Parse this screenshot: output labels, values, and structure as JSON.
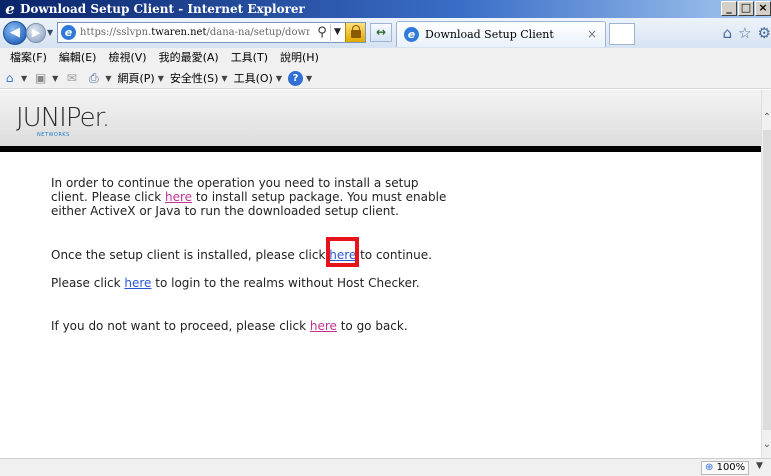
{
  "window": {
    "title": "Download Setup Client - Internet Explorer",
    "buttons": [
      "_",
      "□",
      "×"
    ]
  },
  "address_bar": {
    "url_prefix": "https://sslvpn.",
    "url_domain": "twaren.net",
    "url_path": "/dana-na/setup/download.cg",
    "search_glyph": "⚲",
    "dropdown_glyph": "▼"
  },
  "tab": {
    "label": "Download Setup Client",
    "close": "×"
  },
  "toolbar_icons": [
    "home-icon",
    "star-icon",
    "gear-icon"
  ],
  "menu": {
    "items": [
      "檔案(F)",
      "編輯(E)",
      "檢視(V)",
      "我的最愛(A)",
      "工具(T)",
      "說明(H)"
    ]
  },
  "command_bar": {
    "page_label": "網頁(P)",
    "safety_label": "安全性(S)",
    "tools_label": "工具(O)"
  },
  "logo": {
    "text": "JUNIPer.",
    "sub": "NETWORKS"
  },
  "content": {
    "p1_text_a": "In order to continue the operation you need to install a setup client. Please click ",
    "p1_link": "here",
    "p1_text_b": " to install setup package. You must enable either ActiveX or Java to run the downloaded setup client.",
    "p2_text_a": "Once the setup client is installed, please click ",
    "p2_link": "here",
    "p2_text_b": " to continue.",
    "p3_text_a": "Please click ",
    "p3_link": "here",
    "p3_text_b": " to login to the realms without Host Checker.",
    "p4_text_a": "If you do not want to proceed, please click ",
    "p4_link": "here",
    "p4_text_b": " to go back."
  },
  "status_bar": {
    "zoom": "100%"
  },
  "colors": {
    "visited_link": "#c0328f",
    "link": "#2a57d8",
    "highlight": "#e8121a"
  }
}
